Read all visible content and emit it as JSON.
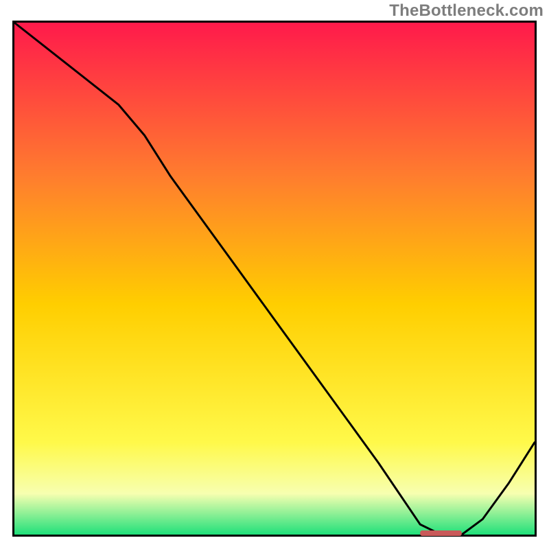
{
  "watermark": {
    "text": "TheBottleneck.com"
  },
  "colors": {
    "gradient_top": "#ff1a4b",
    "gradient_mid1": "#ff7d2e",
    "gradient_mid2": "#ffce00",
    "gradient_mid3": "#fff94a",
    "gradient_bottom": "#1fe07a",
    "frame": "#000000",
    "line": "#000000",
    "marker": "#c95a5a"
  },
  "chart_data": {
    "type": "line",
    "title": "",
    "xlabel": "",
    "ylabel": "",
    "xlim": [
      0,
      100
    ],
    "ylim": [
      0,
      100
    ],
    "grid": false,
    "legend": false,
    "series": [
      {
        "name": "curve",
        "x": [
          0,
          10,
          20,
          25,
          30,
          40,
          50,
          60,
          70,
          78,
          82,
          86,
          90,
          95,
          100
        ],
        "y": [
          100,
          92,
          84,
          78,
          70,
          56,
          42,
          28,
          14,
          2,
          0,
          0,
          3,
          10,
          18
        ]
      }
    ],
    "annotations": [
      {
        "name": "min-marker",
        "x_start": 78,
        "x_end": 86,
        "y": 0
      }
    ]
  }
}
